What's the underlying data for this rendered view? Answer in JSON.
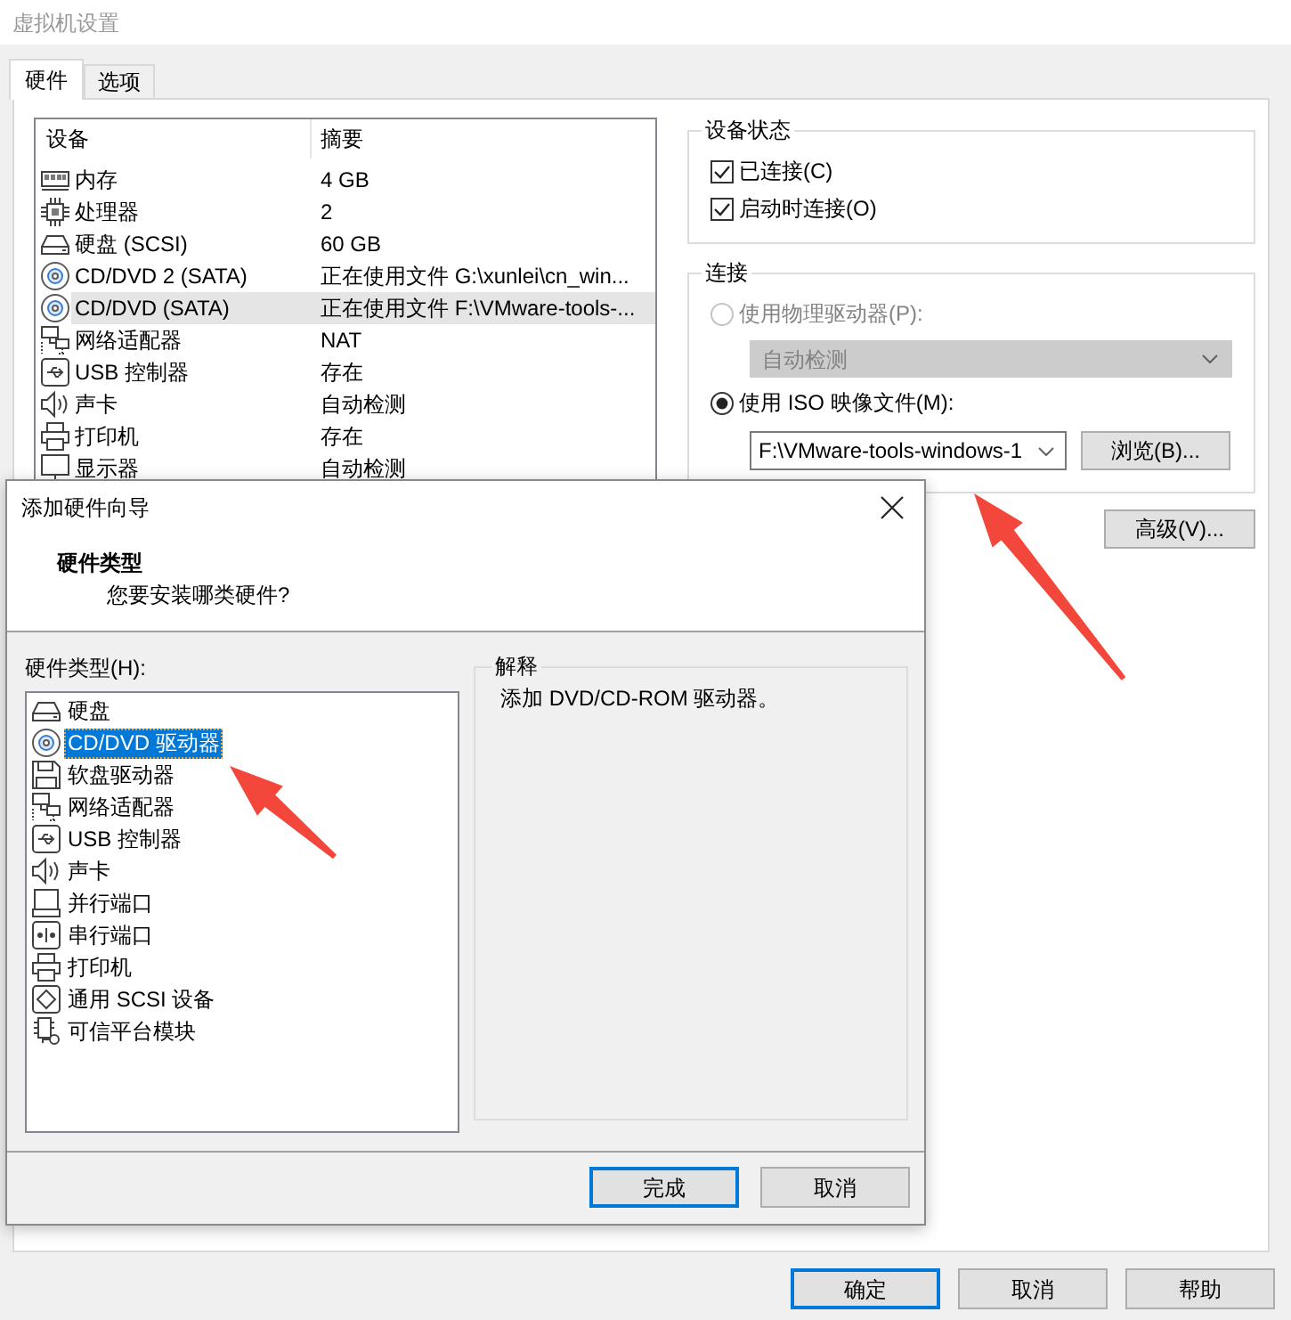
{
  "window": {
    "title": "虚拟机设置"
  },
  "tabs": [
    {
      "label": "硬件",
      "selected": true
    },
    {
      "label": "选项",
      "selected": false
    }
  ],
  "device_table": {
    "columns": [
      "设备",
      "摘要"
    ],
    "rows": [
      {
        "kind": "memory",
        "device": "内存",
        "summary": "4 GB",
        "selected": false
      },
      {
        "kind": "cpu",
        "device": "处理器",
        "summary": "2",
        "selected": false
      },
      {
        "kind": "disk",
        "device": "硬盘 (SCSI)",
        "summary": "60 GB",
        "selected": false
      },
      {
        "kind": "cdrom",
        "device": "CD/DVD 2 (SATA)",
        "summary": "正在使用文件 G:\\xunlei\\cn_win...",
        "selected": false
      },
      {
        "kind": "cdrom",
        "device": "CD/DVD (SATA)",
        "summary": "正在使用文件 F:\\VMware-tools-...",
        "selected": true
      },
      {
        "kind": "network",
        "device": "网络适配器",
        "summary": "NAT",
        "selected": false
      },
      {
        "kind": "usb",
        "device": "USB 控制器",
        "summary": "存在",
        "selected": false
      },
      {
        "kind": "sound",
        "device": "声卡",
        "summary": "自动检测",
        "selected": false
      },
      {
        "kind": "printer",
        "device": "打印机",
        "summary": "存在",
        "selected": false
      },
      {
        "kind": "display",
        "device": "显示器",
        "summary": "自动检测",
        "selected": false
      }
    ]
  },
  "device_status": {
    "title": "设备状态",
    "checkboxes": [
      {
        "label": "已连接(C)",
        "checked": true
      },
      {
        "label": "启动时连接(O)",
        "checked": true
      }
    ]
  },
  "connection": {
    "title": "连接",
    "options": [
      {
        "kind": "dropdown",
        "label": "使用物理驱动器(P):",
        "selected": false,
        "disabled": true,
        "value": "自动检测"
      },
      {
        "kind": "file",
        "label": "使用 ISO 映像文件(M):",
        "selected": true,
        "disabled": false,
        "value": "F:\\VMware-tools-windows-1",
        "button": "浏览(B)..."
      }
    ]
  },
  "advanced_button": "高级(V)...",
  "wizard": {
    "title": "添加硬件向导",
    "heading": "硬件类型",
    "subheading": "您要安装哪类硬件?",
    "list_label": "硬件类型(H):",
    "hardware_types": [
      {
        "kind": "disk",
        "label": "硬盘",
        "selected": false
      },
      {
        "kind": "cdrom",
        "label": "CD/DVD 驱动器",
        "selected": true
      },
      {
        "kind": "floppy",
        "label": "软盘驱动器",
        "selected": false
      },
      {
        "kind": "network",
        "label": "网络适配器",
        "selected": false
      },
      {
        "kind": "usb",
        "label": "USB 控制器",
        "selected": false
      },
      {
        "kind": "sound",
        "label": "声卡",
        "selected": false
      },
      {
        "kind": "parallel",
        "label": "并行端口",
        "selected": false
      },
      {
        "kind": "serial",
        "label": "串行端口",
        "selected": false
      },
      {
        "kind": "printer",
        "label": "打印机",
        "selected": false
      },
      {
        "kind": "scsi",
        "label": "通用 SCSI 设备",
        "selected": false
      },
      {
        "kind": "tpm",
        "label": "可信平台模块",
        "selected": false
      }
    ],
    "explanation": {
      "title": "解释",
      "text": "添加 DVD/CD-ROM 驱动器。"
    },
    "buttons": [
      {
        "label": "完成",
        "default": true
      },
      {
        "label": "取消",
        "default": false
      }
    ]
  },
  "buttons": [
    {
      "label": "确定",
      "default": true
    },
    {
      "label": "取消",
      "default": false
    },
    {
      "label": "帮助",
      "default": false
    }
  ]
}
